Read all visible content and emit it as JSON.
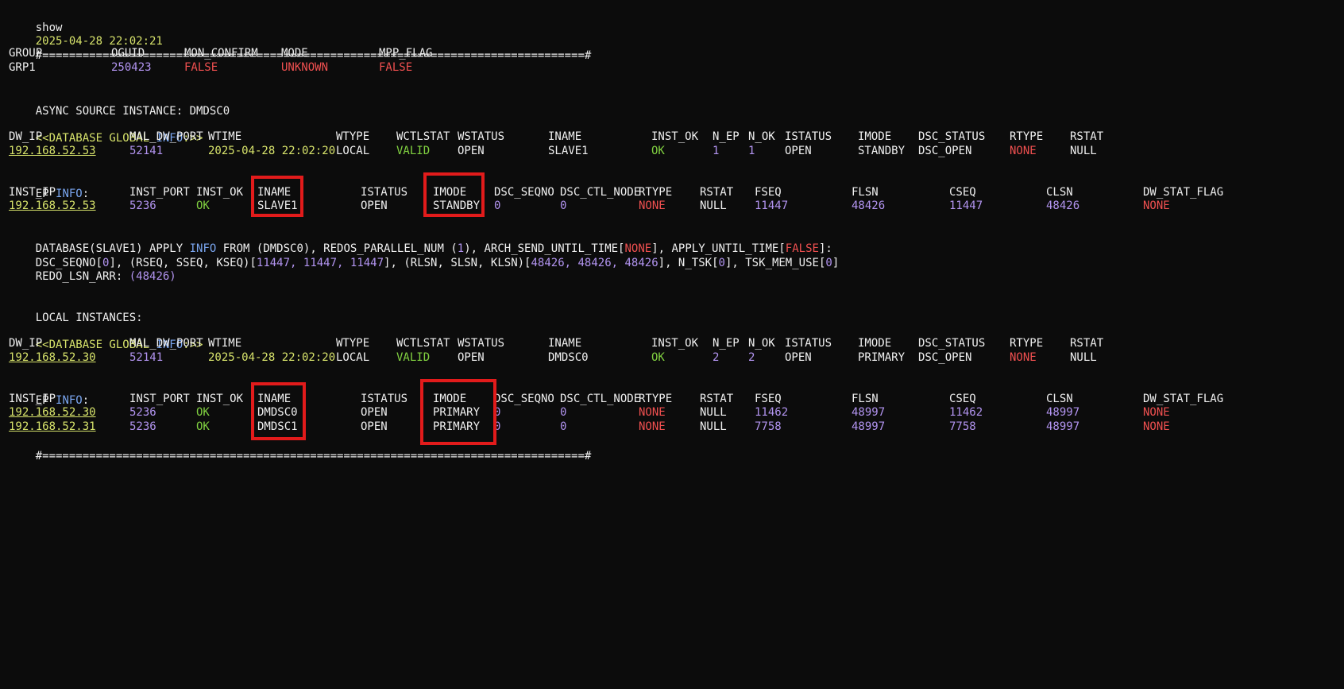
{
  "colors": {
    "background": "#0c0c0c",
    "text": "#f0f0f0",
    "yellow": "#d7e36b",
    "purple": "#b294f0",
    "red": "#f05050",
    "green": "#80d040",
    "blue": "#7aa6f0",
    "highlight_box": "#e21b1b"
  },
  "cmd": "show",
  "timestamp": "2025-04-28 22:02:21",
  "separator": "#=================================================================================#",
  "group": {
    "headers": [
      "GROUP",
      "OGUID",
      "MON_CONFIRM",
      "MODE",
      "MPP_FLAG"
    ],
    "values": [
      "GRP1",
      "250423",
      "FALSE",
      "UNKNOWN",
      "FALSE"
    ]
  },
  "async_source": "ASYNC SOURCE INSTANCE: DMDSC0",
  "dbg_prefix": "<<DATABASE GLOBAL ",
  "dbg_info": "INFO",
  "dbg_suffix": ":>>",
  "dbg_headers": [
    "DW_IP",
    "MAL_DW_PORT",
    "WTIME",
    "WTYPE",
    "WCTLSTAT",
    "WSTATUS",
    "INAME",
    "INST_OK",
    "N_EP",
    "N_OK",
    "ISTATUS",
    "IMODE",
    "DSC_STATUS",
    "RTYPE",
    "RSTAT"
  ],
  "db1": [
    "192.168.52.53",
    "52141",
    "2025-04-28 22:02:20",
    "LOCAL",
    "VALID",
    "OPEN",
    "SLAVE1",
    "OK",
    "1",
    "1",
    "OPEN",
    "STANDBY",
    "DSC_OPEN",
    "NONE",
    "NULL"
  ],
  "ep_prefix": "EP ",
  "ep_info": "INFO",
  "ep_suffix": ":",
  "ep_headers": [
    "INST_IP",
    "INST_PORT",
    "INST_OK",
    "INAME",
    "ISTATUS",
    "IMODE",
    "DSC_SEQNO",
    "DSC_CTL_NODE",
    "RTYPE",
    "RSTAT",
    "FSEQ",
    "FLSN",
    "CSEQ",
    "CLSN",
    "DW_STAT_FLAG"
  ],
  "ep1": [
    "192.168.52.53",
    "5236",
    "OK",
    "SLAVE1",
    "OPEN",
    "STANDBY",
    "0",
    "0",
    "NONE",
    "NULL",
    "11447",
    "48426",
    "11447",
    "48426",
    "NONE"
  ],
  "apply": {
    "l1": [
      "DATABASE(SLAVE1) APPLY ",
      "INFO",
      " FROM (DMDSC0), REDOS_PARALLEL_NUM (",
      "1",
      "), ARCH_SEND_UNTIL_TIME[",
      "NONE",
      "], APPLY_UNTIL_TIME[",
      "FALSE",
      "]:"
    ],
    "l2": [
      "DSC_SEQNO[",
      "0",
      "], (RSEQ, SSEQ, KSEQ)[",
      "11447, 11447, 11447",
      "], (RLSN, SLSN, KLSN)[",
      "48426, 48426, 48426",
      "], N_TSK[",
      "0",
      "], TSK_MEM_USE[",
      "0",
      "]"
    ],
    "l3": [
      "REDO_LSN_ARR: ",
      "(48426)"
    ]
  },
  "local_instances": "LOCAL INSTANCES:",
  "db2": [
    "192.168.52.30",
    "52141",
    "2025-04-28 22:02:20",
    "LOCAL",
    "VALID",
    "OPEN",
    "DMDSC0",
    "OK",
    "2",
    "2",
    "OPEN",
    "PRIMARY",
    "DSC_OPEN",
    "NONE",
    "NULL"
  ],
  "ep2": [
    [
      "192.168.52.30",
      "5236",
      "OK",
      "DMDSC0",
      "OPEN",
      "PRIMARY",
      "0",
      "0",
      "NONE",
      "NULL",
      "11462",
      "48997",
      "11462",
      "48997",
      "NONE"
    ],
    [
      "192.168.52.31",
      "5236",
      "OK",
      "DMDSC1",
      "OPEN",
      "PRIMARY",
      "0",
      "0",
      "NONE",
      "NULL",
      "7758",
      "48997",
      "7758",
      "48997",
      "NONE"
    ]
  ]
}
